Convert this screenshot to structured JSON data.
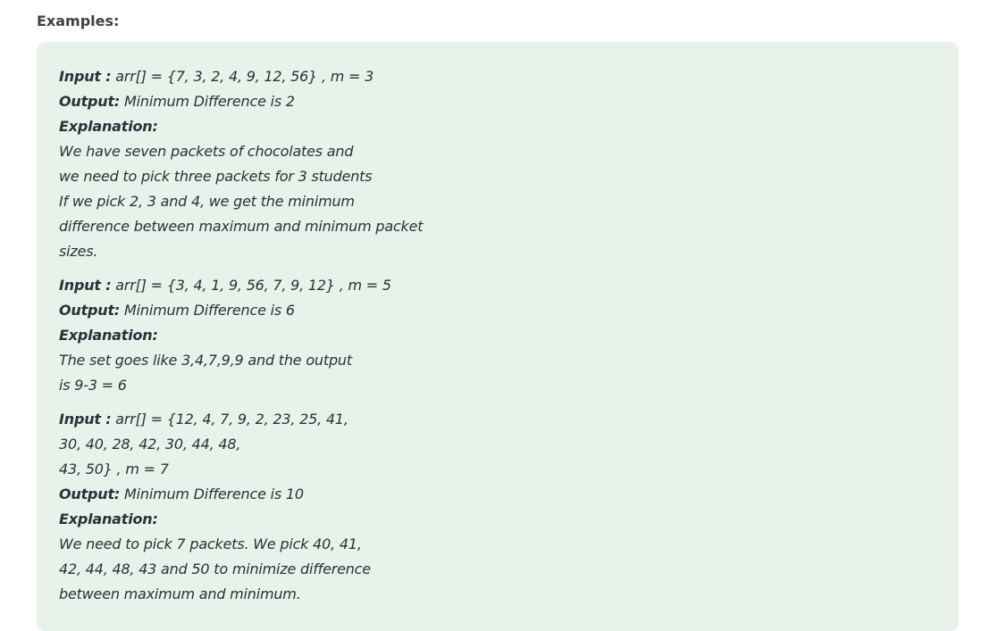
{
  "heading": "Examples:",
  "examples": [
    {
      "input_label": "Input :",
      "input_value": " arr[] = {7, 3, 2, 4, 9, 12, 56} , m = 3",
      "input_extra_lines": [],
      "output_label": "Output:",
      "output_value": " Minimum Difference is 2",
      "explanation_label": "Explanation:",
      "explanation_lines": [
        "We have seven packets of chocolates and",
        "we need to pick three packets for 3 students",
        "If we pick 2, 3 and 4, we get the minimum",
        "difference between maximum and minimum packet",
        "sizes."
      ]
    },
    {
      "input_label": "Input :",
      "input_value": " arr[] = {3, 4, 1, 9, 56, 7, 9, 12} , m = 5",
      "input_extra_lines": [],
      "output_label": "Output:",
      "output_value": " Minimum Difference is 6",
      "explanation_label": "Explanation:",
      "explanation_lines": [
        "The set goes like 3,4,7,9,9 and the output",
        "is 9-3 = 6"
      ]
    },
    {
      "input_label": "Input :",
      "input_value": " arr[] = {12, 4, 7, 9, 2, 23, 25, 41,",
      "input_extra_lines": [
        "30, 40, 28, 42, 30, 44, 48,",
        "43, 50} , m = 7"
      ],
      "output_label": "Output:",
      "output_value": " Minimum Difference is 10",
      "explanation_label": "Explanation:",
      "explanation_lines": [
        "We need to pick 7 packets. We pick 40, 41,",
        "42, 44, 48, 43 and 50 to minimize difference",
        "between maximum and minimum."
      ]
    }
  ]
}
